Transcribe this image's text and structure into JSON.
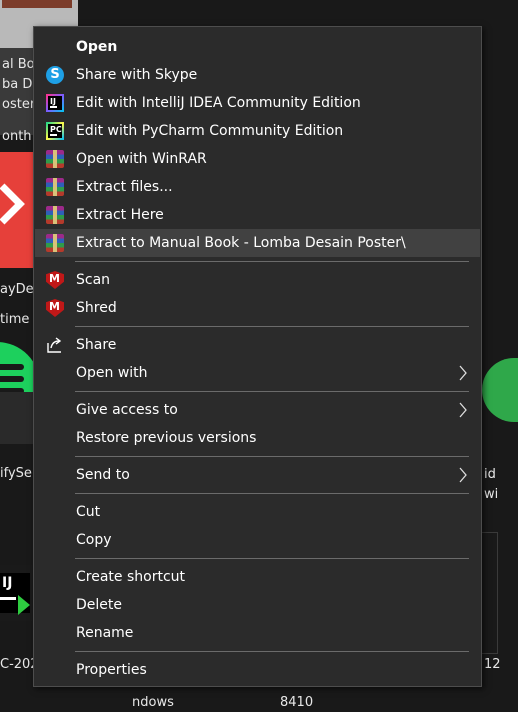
{
  "desktop": {
    "labels": {
      "l1": "al Bo",
      "l2": "ba De",
      "l3": "oster",
      "l4": "onth",
      "l5": "ayDes",
      "l6": "time",
      "l7": "ifySe",
      "l8": "C-202",
      "r1": "id",
      "r2": "wi",
      "r3": "12",
      "b1": "ndows",
      "b2": "8410"
    },
    "ij_letters": "IJ"
  },
  "menu": {
    "items": [
      {
        "label": "Open",
        "icon": "none"
      },
      {
        "label": "Share with Skype",
        "icon": "skype-icon",
        "glyph": "S"
      },
      {
        "label": "Edit with IntelliJ IDEA Community Edition",
        "icon": "intellij-icon",
        "glyph": "IJ"
      },
      {
        "label": "Edit with PyCharm Community Edition",
        "icon": "pycharm-icon",
        "glyph": "PC"
      },
      {
        "label": "Open with WinRAR",
        "icon": "winrar-icon"
      },
      {
        "label": "Extract files...",
        "icon": "winrar-icon"
      },
      {
        "label": "Extract Here",
        "icon": "winrar-icon"
      },
      {
        "label": "Extract to Manual Book - Lomba Desain Poster\\",
        "icon": "winrar-icon"
      },
      {
        "label": "Scan",
        "icon": "mcafee-icon",
        "glyph": "M"
      },
      {
        "label": "Shred",
        "icon": "mcafee-icon",
        "glyph": "M"
      },
      {
        "label": "Share",
        "icon": "share-icon"
      },
      {
        "label": "Open with",
        "icon": "none"
      },
      {
        "label": "Give access to",
        "icon": "none"
      },
      {
        "label": "Restore previous versions",
        "icon": "none"
      },
      {
        "label": "Send to",
        "icon": "none"
      },
      {
        "label": "Cut",
        "icon": "none"
      },
      {
        "label": "Copy",
        "icon": "none"
      },
      {
        "label": "Create shortcut",
        "icon": "none"
      },
      {
        "label": "Delete",
        "icon": "none"
      },
      {
        "label": "Rename",
        "icon": "none"
      },
      {
        "label": "Properties",
        "icon": "none"
      }
    ],
    "highlighted": "Extract to Manual Book - Lomba Desain Poster\\"
  },
  "colors": {
    "menu_bg": "#2b2b2b",
    "highlight": "#414141",
    "separator": "#6b6b6b",
    "skype": "#1ea0e6",
    "mcafee": "#c01818"
  }
}
